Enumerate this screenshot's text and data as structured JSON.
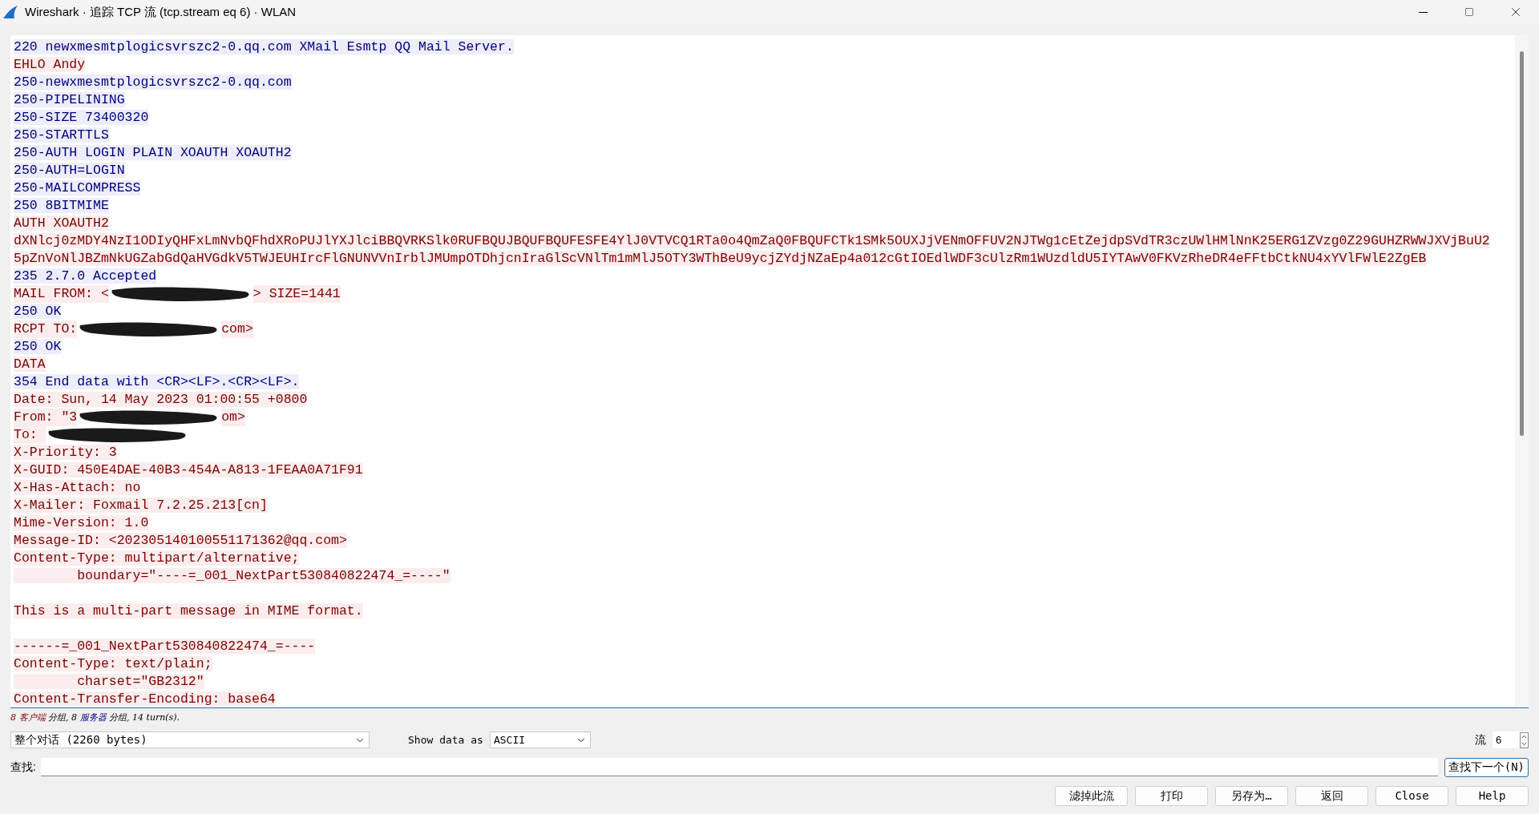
{
  "window": {
    "title": "Wireshark · 追踪 TCP 流 (tcp.stream eq 6) · WLAN"
  },
  "stream_lines": [
    {
      "kind": "server",
      "text": "220 newxmesmtplogicsvrszc2-0.qq.com XMail Esmtp QQ Mail Server."
    },
    {
      "kind": "client",
      "text": "EHLO Andy"
    },
    {
      "kind": "server",
      "text": "250-newxmesmtplogicsvrszc2-0.qq.com"
    },
    {
      "kind": "server",
      "text": "250-PIPELINING"
    },
    {
      "kind": "server",
      "text": "250-SIZE 73400320"
    },
    {
      "kind": "server",
      "text": "250-STARTTLS"
    },
    {
      "kind": "server",
      "text": "250-AUTH LOGIN PLAIN XOAUTH XOAUTH2"
    },
    {
      "kind": "server",
      "text": "250-AUTH=LOGIN"
    },
    {
      "kind": "server",
      "text": "250-MAILCOMPRESS"
    },
    {
      "kind": "server",
      "text": "250 8BITMIME"
    },
    {
      "kind": "client",
      "text": "AUTH XOAUTH2"
    },
    {
      "kind": "client",
      "text": "dXNlcj0zMDY4NzI1ODIyQHFxLmNvbQFhdXRoPUJlYXJlciBBQVRKSlk0RUFBQUJBQUFBQUFESFE4YlJ0VTVCQ1RTa0o4QmZaQ0FBQUFCTk1SMk5OUXJjVENmOFFUV2NJTWg1cEtZejdpSVdTR3czUWlHMlNnK25ERG1ZVzg0Z29GUHZRWWJXVjBuU2"
    },
    {
      "kind": "client",
      "text": "5pZnVoNlJBZmNkUGZabGdQaHVGdkV5TWJEUHIrcFlGNUNVVnIrblJMUmpOTDhjcnIraGlScVNlTm1mMlJ5OTY3WThBeU9ycjZYdjNZaEp4a012cGtIOEdlWDF3cUlzRm1WUzdldU5IYTAwV0FKVzRheDR4eFFtbCtkNU4xYVlFWlE2ZgEB"
    },
    {
      "kind": "server",
      "text": "235 2.7.0 Accepted"
    },
    {
      "kind": "client",
      "text": "MAIL FROM: <",
      "redacted": true,
      "after": "> SIZE=1441"
    },
    {
      "kind": "server",
      "text": "250 OK"
    },
    {
      "kind": "client",
      "text": "RCPT TO:",
      "redacted": true,
      "after": "com>"
    },
    {
      "kind": "server",
      "text": "250 OK"
    },
    {
      "kind": "client",
      "text": "DATA"
    },
    {
      "kind": "server",
      "text": "354 End data with <CR><LF>.<CR><LF>."
    },
    {
      "kind": "client",
      "text": "Date: Sun, 14 May 2023 01:00:55 +0800"
    },
    {
      "kind": "client",
      "text": "From: \"3",
      "redacted": true,
      "after": "om>"
    },
    {
      "kind": "client",
      "text": "To: ",
      "redacted": true
    },
    {
      "kind": "client",
      "text": "X-Priority: 3"
    },
    {
      "kind": "client",
      "text": "X-GUID: 450E4DAE-40B3-454A-A813-1FEAA0A71F91"
    },
    {
      "kind": "client",
      "text": "X-Has-Attach: no"
    },
    {
      "kind": "client",
      "text": "X-Mailer: Foxmail 7.2.25.213[cn]"
    },
    {
      "kind": "client",
      "text": "Mime-Version: 1.0"
    },
    {
      "kind": "client",
      "text": "Message-ID: <202305140100551171362@qq.com>"
    },
    {
      "kind": "client",
      "text": "Content-Type: multipart/alternative;"
    },
    {
      "kind": "client",
      "text": "        boundary=\"----=_001_NextPart530840822474_=----\""
    },
    {
      "kind": "blank"
    },
    {
      "kind": "client",
      "text": "This is a multi-part message in MIME format."
    },
    {
      "kind": "blank"
    },
    {
      "kind": "client",
      "text": "------=_001_NextPart530840822474_=----"
    },
    {
      "kind": "client",
      "text": "Content-Type: text/plain;"
    },
    {
      "kind": "client",
      "text": "        charset=\"GB2312\""
    },
    {
      "kind": "client",
      "text": "Content-Transfer-Encoding: base64"
    }
  ],
  "summary": [
    {
      "kind": "client",
      "text": "8 "
    },
    {
      "kind": "client",
      "text": "客户端"
    },
    {
      "kind": "plain",
      "text": " 分组, 8 "
    },
    {
      "kind": "server",
      "text": "服务器"
    },
    {
      "kind": "plain",
      "text": " 分组, 14 turn(s)."
    }
  ],
  "conversation_select": {
    "value": "整个对话 (2260 bytes)"
  },
  "show_data_as": {
    "label": "Show data as",
    "value": "ASCII"
  },
  "stream": {
    "label": "流",
    "value": "6"
  },
  "find": {
    "label": "查找:",
    "button": "查找下一个(N)"
  },
  "buttons": [
    "滤掉此流",
    "打印",
    "另存为…",
    "返回",
    "Close",
    "Help"
  ]
}
